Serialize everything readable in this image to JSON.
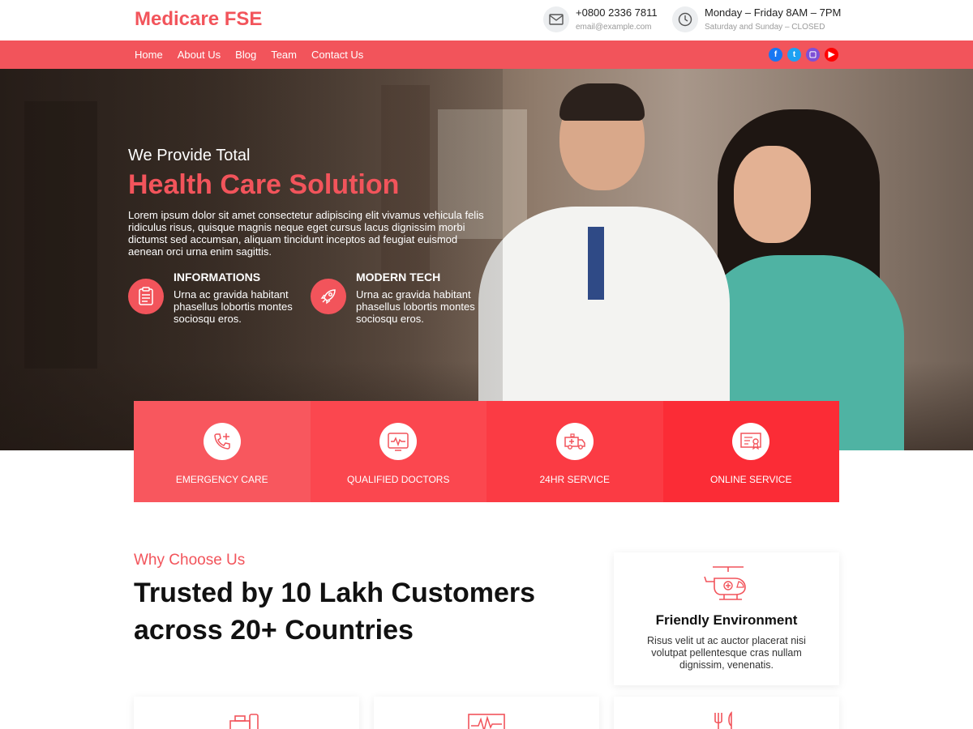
{
  "brand": {
    "name": "Medicare FSE",
    "accent": "#f2545b"
  },
  "contact": {
    "phone": "+0800 2336 7811",
    "email": "email@example.com",
    "hours": "Monday – Friday 8AM – 7PM",
    "weekend": "Saturday and Sunday – CLOSED"
  },
  "nav": {
    "items": [
      {
        "label": "Home"
      },
      {
        "label": "About Us"
      },
      {
        "label": "Blog"
      },
      {
        "label": "Team"
      },
      {
        "label": "Contact Us"
      }
    ]
  },
  "social": [
    {
      "icon": "facebook-icon",
      "color": "#1877f2",
      "glyph": "f"
    },
    {
      "icon": "twitter-icon",
      "color": "#1da1f2",
      "glyph": "t"
    },
    {
      "icon": "twitch-icon",
      "color": "#7e4fd6",
      "glyph": "▢"
    },
    {
      "icon": "youtube-icon",
      "color": "#ff0000",
      "glyph": "▶"
    }
  ],
  "hero": {
    "pretitle": "We Provide Total",
    "title": "Health Care Solution",
    "description": "Lorem ipsum dolor sit amet consectetur adipiscing elit vivamus vehicula felis ridiculus risus, quisque magnis neque eget cursus lacus dignissim morbi dictumst sed accumsan, aliquam tincidunt inceptos ad feugiat euismod aenean orci urna enim sagittis.",
    "features": [
      {
        "title": "INFORMATIONS",
        "text": "Urna ac gravida habitant phasellus lobortis montes sociosqu eros.",
        "icon": "clipboard-icon"
      },
      {
        "title": "MODERN TECH",
        "text": "Urna ac gravida habitant phasellus lobortis montes sociosqu eros.",
        "icon": "rocket-icon"
      }
    ]
  },
  "services": [
    {
      "label": "EMERGENCY CARE",
      "color": "#f8575e",
      "icon": "phone-plus-icon"
    },
    {
      "label": "QUALIFIED DOCTORS",
      "color": "#fb474f",
      "icon": "heart-monitor-icon"
    },
    {
      "label": "24HR SERVICE",
      "color": "#fb3b44",
      "icon": "ambulance-icon"
    },
    {
      "label": "ONLINE SERVICE",
      "color": "#fb2c36",
      "icon": "certificate-icon"
    }
  ],
  "why": {
    "kicker": "Why Choose Us",
    "headline": "Trusted by 10 Lakh Customers across 20+ Countries"
  },
  "card": {
    "title": "Friendly Environment",
    "text": "Risus velit ut ac auctor placerat nisi volutpat pellentesque cras nullam dignissim, venenatis.",
    "icon": "helicopter-icon"
  }
}
